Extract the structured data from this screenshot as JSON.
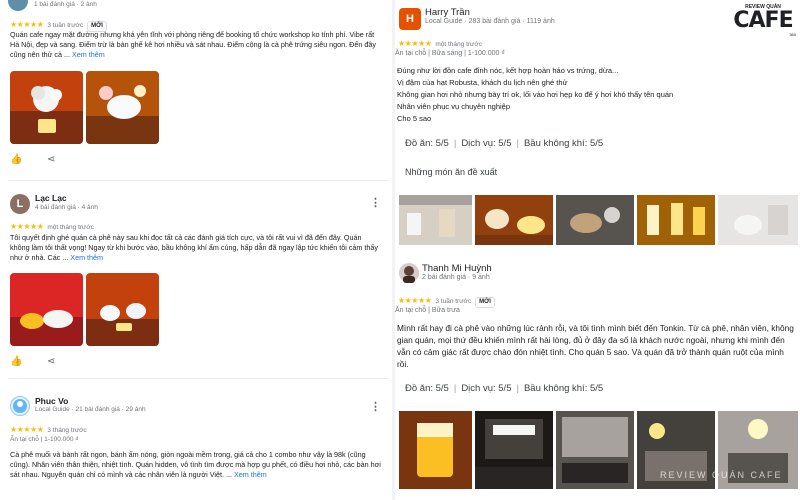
{
  "left": {
    "top_snippet": {
      "meta": "1 bài đánh giá · 2 ảnh",
      "stars": "★★★★★",
      "when": "3 tuần trước",
      "badge": "MỚI",
      "text": "Quán cafe ngay mặt đường nhưng khá yên tĩnh với phòng riêng để booking tổ chức workshop ko tính phí. Vibe rất Hà Nội, đẹp và sang. Điểm trừ là bàn ghế kê hơi nhiều và sát nhau. Điểm cộng là cà phê trứng siêu ngon. Đến đây cũng nên thử cả ...",
      "see_more": "Xem thêm"
    },
    "review2": {
      "avatar_letter": "L",
      "name": "Lạc Lạc",
      "meta": "4 bài đánh giá · 4 ảnh",
      "stars": "★★★★★",
      "when": "một tháng trước",
      "text": "Tôi quyết định ghé quán cà phê này sau khi đọc tất cả các đánh giá tích cực, và tôi rất vui vì đã đến đây. Quán không làm tôi thất vọng! Ngay từ khi bước vào, bầu không khí ấm cúng, hấp dẫn đã ngay lập tức khiến tôi cảm thấy như ở nhà. Các ...",
      "see_more": "Xem thêm"
    },
    "review3": {
      "name": "Phuc Vo",
      "meta": "Local Guide · 21 bài đánh giá · 29 ảnh",
      "stars": "★★★★★",
      "when": "3 tháng trước",
      "sub": "Ăn tại chỗ | 1-100.000 ₫",
      "text": "Cà phê muối và bánh rất ngon, bánh ấm nóng, giòn ngoài mềm trong, giá cả cho 1 combo như vậy là 98k (cũng cũng). Nhân viên thân thiện, nhiệt tình. Quán hidden, vô tình tìm được mà hợp gu phết, có điều hơi nhỏ, các bàn hơi sát nhau. Nguyên quán chỉ có mình và các nhân viên là người Việt. ...",
      "see_more": "Xem thêm"
    }
  },
  "right": {
    "logo": {
      "top": "REVIEW QUÁN",
      "main": "CAFE",
      "sub": "360"
    },
    "review1": {
      "avatar_letter": "H",
      "name": "Harry Trần",
      "meta": "Local Guide · 283 bài đánh giá · 1119 ảnh",
      "stars": "★★★★★",
      "when": "một tháng trước",
      "sub": "Ăn tại chỗ | Bữa sáng | 1-100.000 ₫",
      "lines": [
        "Đúng như lời đồn cafe đỉnh nóc, kết hợp hoàn hảo vs trứng, dừa...",
        "Vị đậm của hạt Robusta, khách du lịch nên ghé thử",
        "Không gian hơi nhỏ nhưng bày trí ok, lối vào hơi hẹp ko để ý hơi khó thấy tên quán",
        "Nhân viên phục vụ chuyên nghiệp",
        "Cho 5 sao"
      ],
      "scores": [
        "Đồ ăn: 5/5",
        "Dịch vụ: 5/5",
        "Bầu không khí: 5/5"
      ],
      "suggest": "Những món ăn đề xuất"
    },
    "review2": {
      "name": "Thanh Mi Huỳnh",
      "meta": "2 bài đánh giá · 9 ảnh",
      "stars": "★★★★★",
      "when": "3 tuần trước",
      "badge": "MỚI",
      "sub": "Ăn tại chỗ | Bữa trưa",
      "text": "Mình rất hay đi cà phê vào những lúc rảnh rỗi, và tôi tình mình biết đến Tonkin. Từ cà phê, nhân viên, không gian quán, mọi thứ đều khiến mình rất hài lòng, đủ ở đây đa số là khách nước ngoài, nhưng khi mình đến vẫn có cảm giác rất được chào đón nhiệt tình. Cho quán 5 sao. Và quán đã trở thành quán ruột của mình rồi.",
      "scores": [
        "Đồ ăn: 5/5",
        "Dịch vụ: 5/5",
        "Bầu không khí: 5/5"
      ]
    },
    "watermark": "REVIEW QUÁN CAFE"
  },
  "colors": {
    "star": "#fbbc04",
    "link": "#1a73e8",
    "avatar_L": "#8d6e63",
    "avatar_H": "#e65100"
  }
}
